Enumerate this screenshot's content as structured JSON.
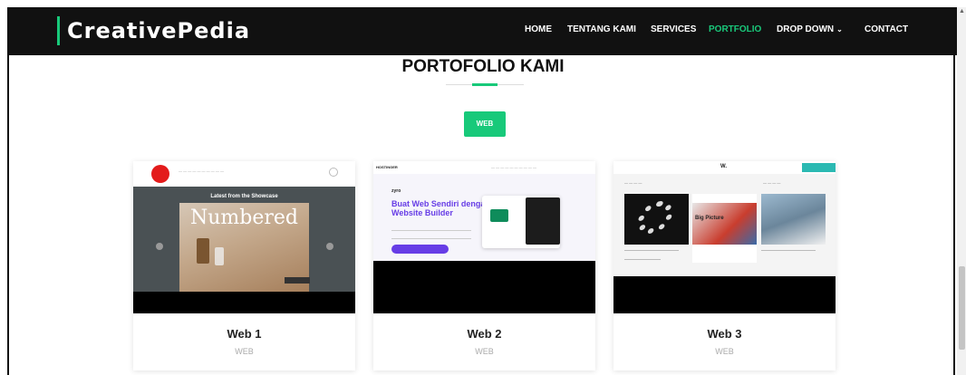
{
  "header": {
    "brand": "CreativePedia",
    "nav": [
      {
        "label": "HOME",
        "active": false
      },
      {
        "label": "TENTANG KAMI",
        "active": false
      },
      {
        "label": "SERVICES",
        "active": false
      },
      {
        "label": "PORTFOLIO",
        "active": true
      },
      {
        "label": "DROP DOWN",
        "active": false
      },
      {
        "label": "CONTACT",
        "active": false
      }
    ],
    "dropdown_icon": "chevron-down-icon"
  },
  "portfolio": {
    "title": "PORTOFOLIO KAMI",
    "filter_label": "WEB",
    "items": [
      {
        "title": "Web 1",
        "category": "WEB",
        "preview": {
          "heading": "Latest from the Showcase",
          "word": "Numbered"
        }
      },
      {
        "title": "Web 2",
        "category": "WEB",
        "preview": {
          "brand": "HOSTINGER",
          "headline": "Buat Web Sendiri dengan Website Builder"
        }
      },
      {
        "title": "Web 3",
        "category": "WEB",
        "preview": {
          "brand": "W.",
          "featured": "Big Picture"
        }
      }
    ]
  },
  "colors": {
    "accent": "#18c97a",
    "navbar": "#111111",
    "text": "#222222",
    "muted": "#aaaaaa",
    "preview_purple": "#673de6"
  }
}
